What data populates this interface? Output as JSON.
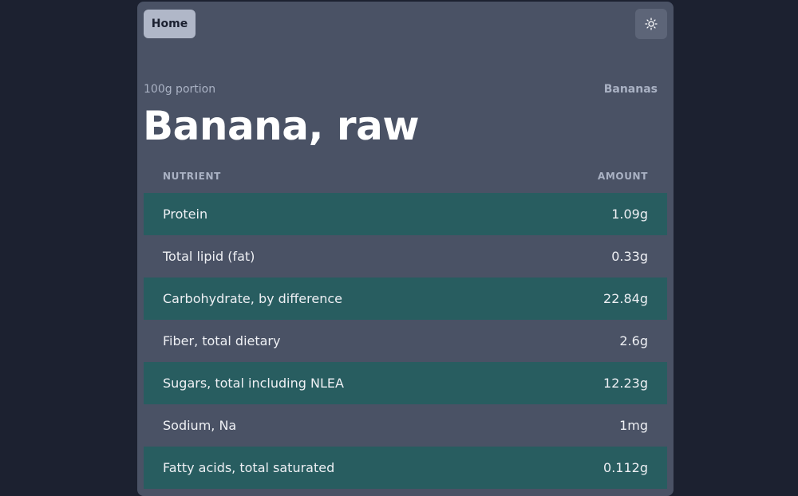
{
  "header": {
    "home_label": "Home",
    "theme_icon": "sun-icon"
  },
  "food": {
    "portion": "100g portion",
    "category": "Bananas",
    "title": "Banana, raw"
  },
  "table": {
    "columns": [
      "NUTRIENT",
      "AMOUNT"
    ],
    "rows": [
      {
        "nutrient": "Protein",
        "amount": "1.09g"
      },
      {
        "nutrient": "Total lipid (fat)",
        "amount": "0.33g"
      },
      {
        "nutrient": "Carbohydrate, by difference",
        "amount": "22.84g"
      },
      {
        "nutrient": "Fiber, total dietary",
        "amount": "2.6g"
      },
      {
        "nutrient": "Sugars, total including NLEA",
        "amount": "12.23g"
      },
      {
        "nutrient": "Sodium, Na",
        "amount": "1mg"
      },
      {
        "nutrient": "Fatty acids, total saturated",
        "amount": "0.112g"
      }
    ]
  },
  "colors": {
    "page_bg": "#1c2130",
    "card_bg": "#4a5265",
    "row_highlight": "#285d60",
    "home_button_bg": "#b0b7c8"
  }
}
